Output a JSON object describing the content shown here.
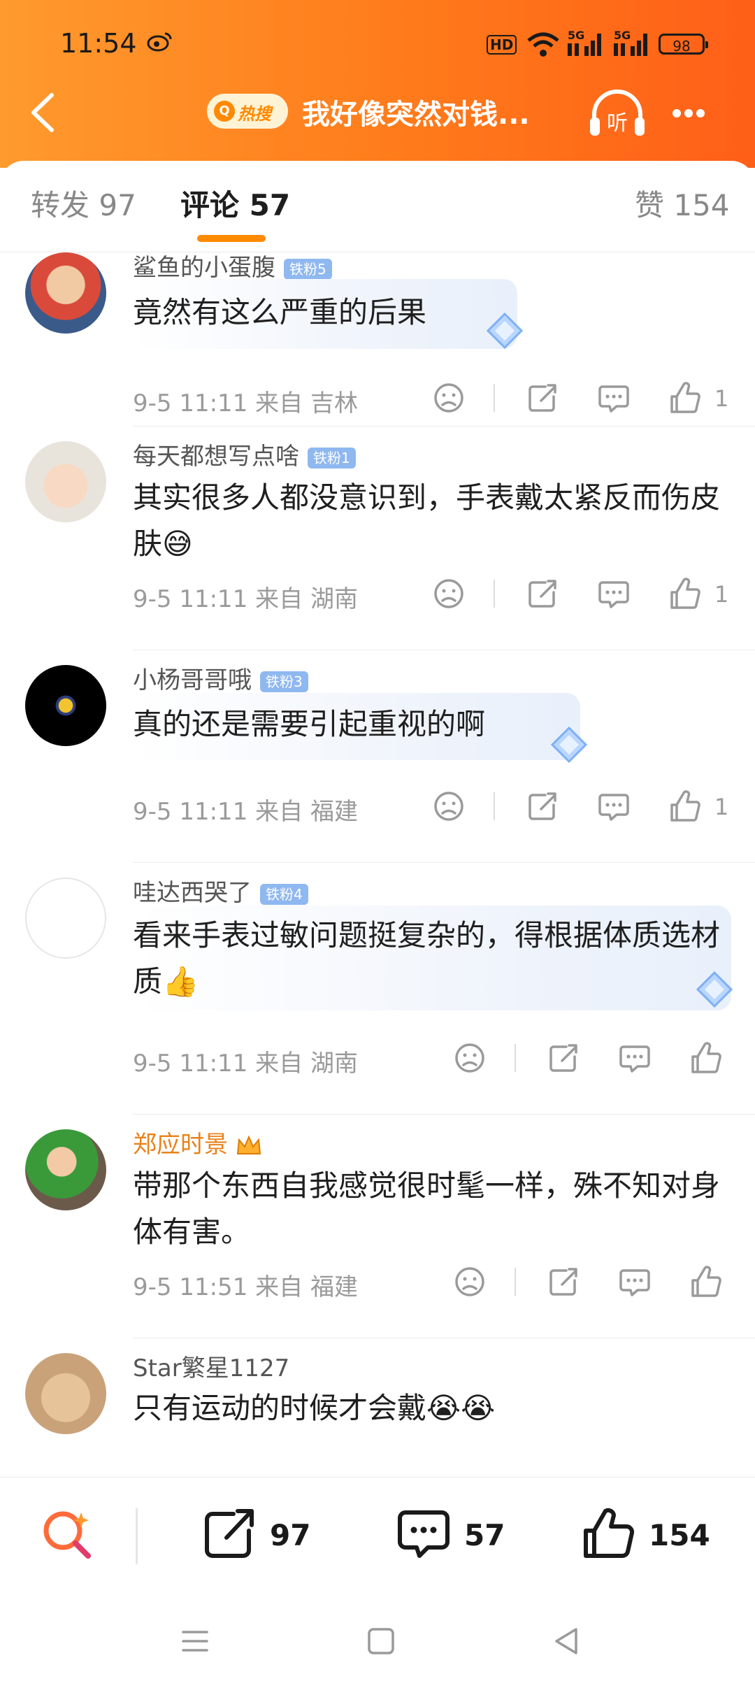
{
  "status_bar": {
    "time": "11:54",
    "hd": "HD",
    "signal1": "5G",
    "signal2": "5G",
    "battery": "98"
  },
  "header": {
    "hot_badge": "热搜",
    "title": "我好像突然对钱...",
    "listen_label": "听"
  },
  "tabs": [
    {
      "label": "转发 97"
    },
    {
      "label": "评论 57"
    },
    {
      "label": "赞 154"
    }
  ],
  "comments": [
    {
      "user": "鲨鱼的小蛋腹",
      "fan_badge": "铁粉5",
      "text": "竟然有这么严重的后果",
      "date": "9-5 11:11",
      "location": "来自 吉林",
      "likes": "1"
    },
    {
      "user": "每天都想写点啥",
      "fan_badge": "铁粉1",
      "text": "其实很多人都没意识到，手表戴太紧反而伤皮肤😅",
      "date": "9-5 11:11",
      "location": "来自 湖南",
      "likes": "1"
    },
    {
      "user": "小杨哥哥哦",
      "fan_badge": "铁粉3",
      "text": "真的还是需要引起重视的啊",
      "date": "9-5 11:11",
      "location": "来自 福建",
      "likes": "1"
    },
    {
      "user": "哇达西哭了",
      "fan_badge": "铁粉4",
      "text": "看来手表过敏问题挺复杂的，得根据体质选材质👍",
      "date": "9-5 11:11",
      "location": "来自 湖南",
      "likes": ""
    },
    {
      "user": "郑应时景",
      "fan_badge": "",
      "text": "带那个东西自我感觉很时髦一样，殊不知对身体有害。",
      "date": "9-5 11:51",
      "location": "来自 福建",
      "likes": ""
    },
    {
      "user": "Star繁星1127",
      "fan_badge": "",
      "text": "只有运动的时候才会戴😭😭",
      "date": "",
      "location": "",
      "likes": ""
    }
  ],
  "bottom_bar": {
    "repost_count": "97",
    "comment_count": "57",
    "like_count": "154"
  },
  "colors": {
    "header_orange": "#ff7a1a",
    "accent": "#ff8a00",
    "gold_name": "#e8821a"
  }
}
